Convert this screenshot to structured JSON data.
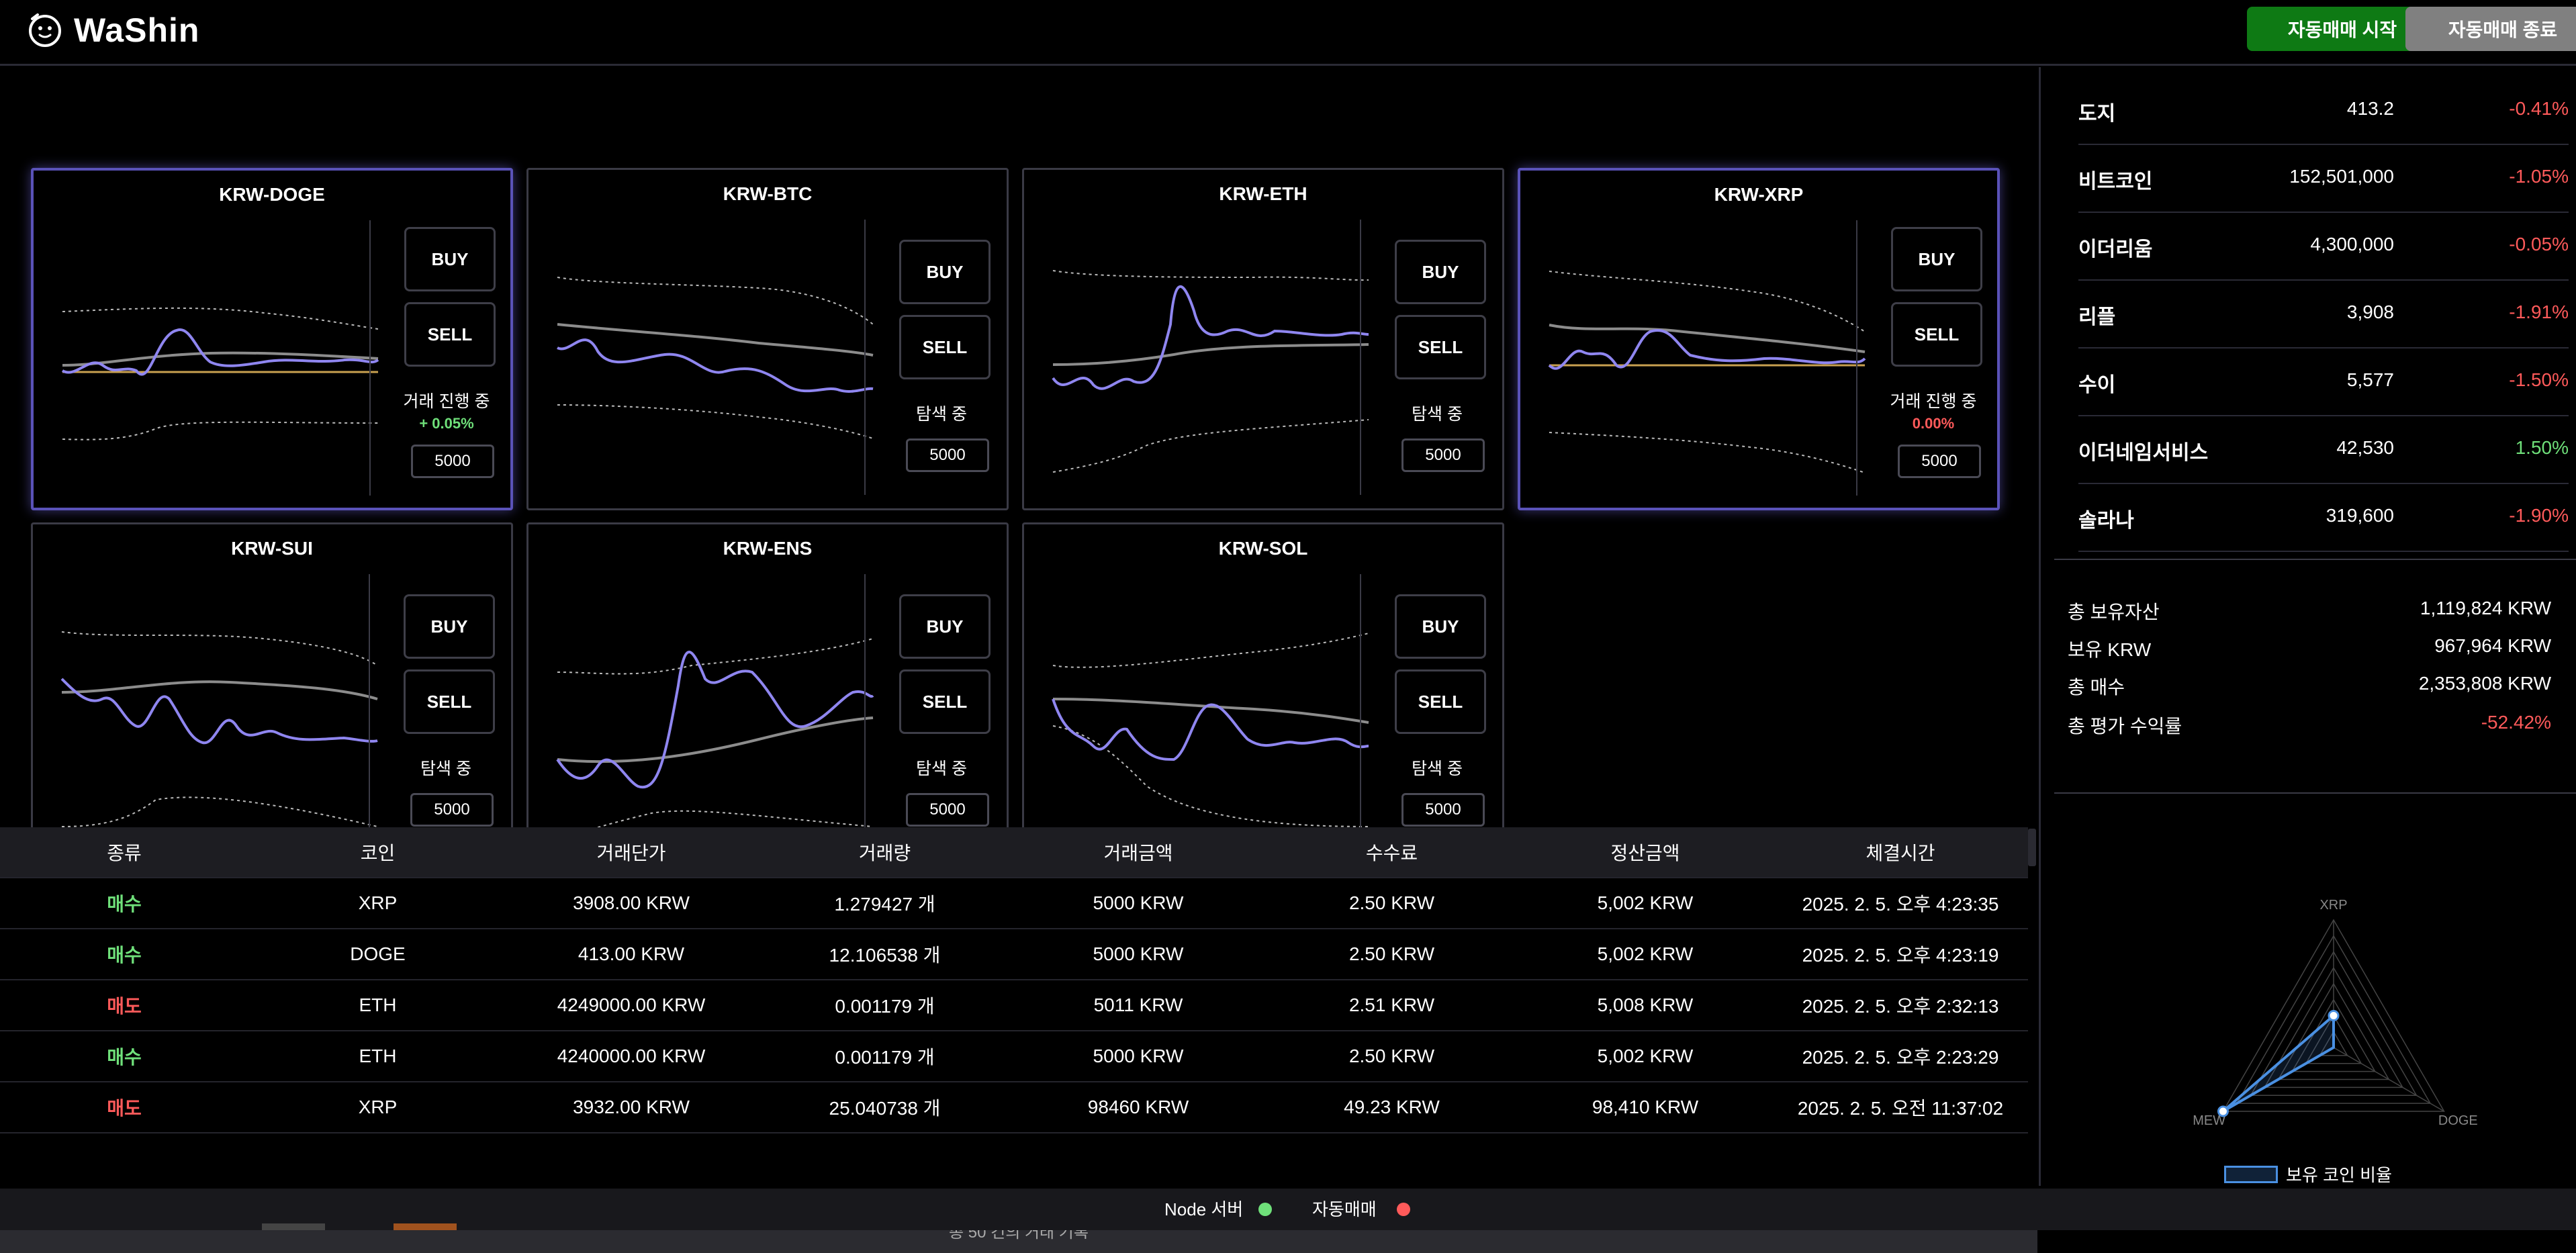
{
  "app": {
    "title": "WaShin"
  },
  "header": {
    "start_label": "자동매매 시작",
    "stop_label": "자동매매 종료"
  },
  "cards": [
    {
      "symbol": "KRW-DOGE",
      "buy": "BUY",
      "sell": "SELL",
      "status": "거래 진행 중",
      "pct": "+ 0.05%",
      "pct_color": "#6fe07a",
      "amount": "5000",
      "active": true
    },
    {
      "symbol": "KRW-BTC",
      "buy": "BUY",
      "sell": "SELL",
      "status": "탐색 중",
      "pct": "",
      "amount": "5000",
      "active": false
    },
    {
      "symbol": "KRW-ETH",
      "buy": "BUY",
      "sell": "SELL",
      "status": "탐색 중",
      "pct": "",
      "amount": "5000",
      "active": false
    },
    {
      "symbol": "KRW-XRP",
      "buy": "BUY",
      "sell": "SELL",
      "status": "거래 진행 중",
      "pct": "0.00%",
      "pct_color": "#ff5a5a",
      "amount": "5000",
      "active": true
    },
    {
      "symbol": "KRW-SUI",
      "buy": "BUY",
      "sell": "SELL",
      "status": "탐색 중",
      "pct": "",
      "amount": "5000",
      "active": false
    },
    {
      "symbol": "KRW-ENS",
      "buy": "BUY",
      "sell": "SELL",
      "status": "탐색 중",
      "pct": "",
      "amount": "5000",
      "active": false
    },
    {
      "symbol": "KRW-SOL",
      "buy": "BUY",
      "sell": "SELL",
      "status": "탐색 중",
      "pct": "",
      "amount": "5000",
      "active": false
    }
  ],
  "table": {
    "headers": [
      "종류",
      "코인",
      "거래단가",
      "거래량",
      "거래금액",
      "수수료",
      "정산금액",
      "체결시간"
    ],
    "rows": [
      [
        "매수",
        "XRP",
        "3908.00 KRW",
        "1.279427 개",
        "5000 KRW",
        "2.50 KRW",
        "5,002 KRW",
        "2025. 2. 5. 오후 4:23:35"
      ],
      [
        "매수",
        "DOGE",
        "413.00 KRW",
        "12.106538 개",
        "5000 KRW",
        "2.50 KRW",
        "5,002 KRW",
        "2025. 2. 5. 오후 4:23:19"
      ],
      [
        "매도",
        "ETH",
        "4249000.00 KRW",
        "0.001179 개",
        "5011 KRW",
        "2.51 KRW",
        "5,008 KRW",
        "2025. 2. 5. 오후 2:32:13"
      ],
      [
        "매수",
        "ETH",
        "4240000.00 KRW",
        "0.001179 개",
        "5000 KRW",
        "2.50 KRW",
        "5,002 KRW",
        "2025. 2. 5. 오후 2:23:29"
      ],
      [
        "매도",
        "XRP",
        "3932.00 KRW",
        "25.040738 개",
        "98460 KRW",
        "49.23 KRW",
        "98,410 KRW",
        "2025. 2. 5. 오전 11:37:02"
      ]
    ],
    "footer": "총 50 건의 거래 기록"
  },
  "coins": [
    {
      "name": "도지",
      "price": "413.2",
      "change": "-0.41%",
      "dir": "neg"
    },
    {
      "name": "비트코인",
      "price": "152,501,000",
      "change": "-1.05%",
      "dir": "neg"
    },
    {
      "name": "이더리움",
      "price": "4,300,000",
      "change": "-0.05%",
      "dir": "neg"
    },
    {
      "name": "리플",
      "price": "3,908",
      "change": "-1.91%",
      "dir": "neg"
    },
    {
      "name": "수이",
      "price": "5,577",
      "change": "-1.50%",
      "dir": "neg"
    },
    {
      "name": "이더네임서비스",
      "price": "42,530",
      "change": "1.50%",
      "dir": "pos"
    },
    {
      "name": "솔라나",
      "price": "319,600",
      "change": "-1.90%",
      "dir": "neg"
    }
  ],
  "summary": {
    "total_assets_label": "총 보유자산",
    "total_assets": "1,119,824 KRW",
    "krw_label": "보유 KRW",
    "krw": "967,964 KRW",
    "total_buy_label": "총 매수",
    "total_buy": "2,353,808 KRW",
    "pnl_label": "총 평가 수익률",
    "pnl": "-52.42%"
  },
  "radar": {
    "labels": [
      "XRP",
      "DOGE",
      "MEW"
    ],
    "values": [
      0.25,
      0.0,
      1.0
    ],
    "legend": "보유 코인 비율",
    "color": "#4a90e2"
  },
  "statusbar": {
    "node_label": "Node 서버",
    "node_color": "#6fe07a",
    "auto_label": "자동매매",
    "auto_color": "#ff5a5a"
  }
}
